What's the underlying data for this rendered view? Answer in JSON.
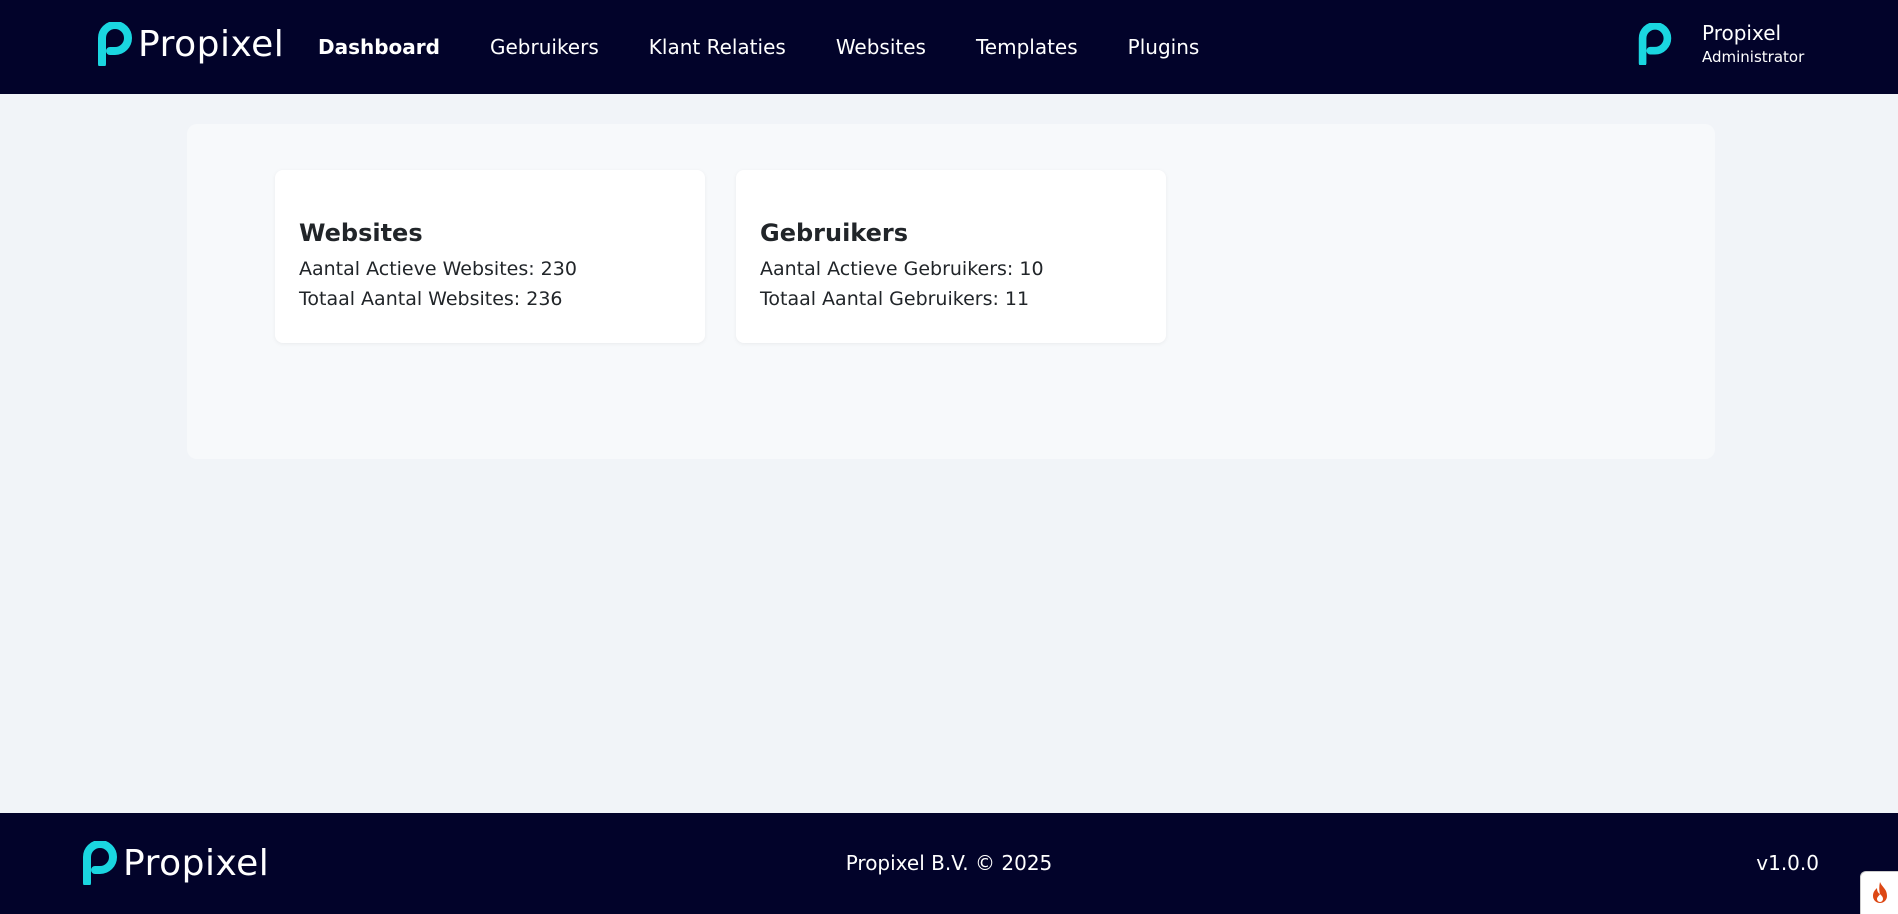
{
  "brand": {
    "name": "Propixel",
    "color": "#1ad6e0",
    "background": "#02032a"
  },
  "nav": {
    "items": [
      {
        "label": "Dashboard",
        "active": true
      },
      {
        "label": "Gebruikers",
        "active": false
      },
      {
        "label": "Klant Relaties",
        "active": false
      },
      {
        "label": "Websites",
        "active": false
      },
      {
        "label": "Templates",
        "active": false
      },
      {
        "label": "Plugins",
        "active": false
      }
    ]
  },
  "user": {
    "name": "Propixel",
    "role": "Administrator",
    "avatar_icon": "propixel-logo-icon"
  },
  "cards": [
    {
      "title": "Websites",
      "lines": [
        "Aantal Actieve Websites: 230",
        "Totaal Aantal Websites: 236"
      ]
    },
    {
      "title": "Gebruikers",
      "lines": [
        "Aantal Actieve Gebruikers: 10",
        "Totaal Aantal Gebruikers: 11"
      ]
    }
  ],
  "footer": {
    "brand": "Propixel",
    "copyright": "Propixel B.V. © 2025",
    "version": "v1.0.0"
  },
  "debug_toolbar": {
    "icon": "flame-icon",
    "color": "#dd4814"
  }
}
